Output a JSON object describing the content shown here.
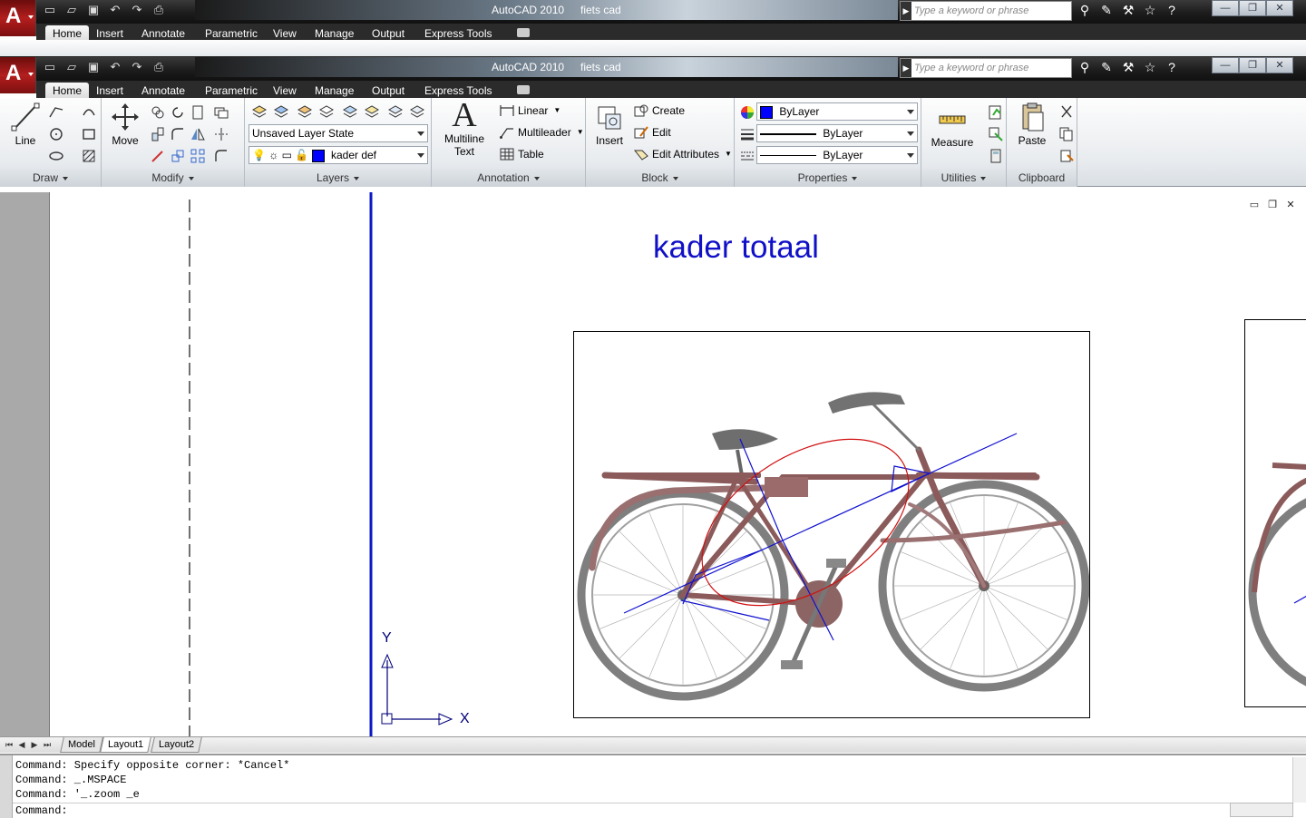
{
  "window": {
    "app_title": "AutoCAD 2010",
    "document_title": "fiets cad",
    "search_placeholder": "Type a keyword or phrase"
  },
  "menu_tabs": [
    "Home",
    "Insert",
    "Annotate",
    "Parametric",
    "View",
    "Manage",
    "Output",
    "Express Tools"
  ],
  "ribbon": {
    "draw": {
      "title": "Draw",
      "line_label": "Line"
    },
    "modify": {
      "title": "Modify",
      "move_label": "Move"
    },
    "layers": {
      "title": "Layers",
      "layer_state": "Unsaved Layer State",
      "current_layer": "kader def"
    },
    "annotation": {
      "title": "Annotation",
      "mtext_line1": "Multiline",
      "mtext_line2": "Text",
      "linear": "Linear",
      "multileader": "Multileader",
      "table": "Table"
    },
    "block": {
      "title": "Block",
      "insert": "Insert",
      "create": "Create",
      "edit": "Edit",
      "edit_attributes": "Edit Attributes"
    },
    "properties": {
      "title": "Properties",
      "color": "ByLayer",
      "lineweight": "ByLayer",
      "linetype": "ByLayer"
    },
    "utilities": {
      "title": "Utilities",
      "measure": "Measure"
    },
    "clipboard": {
      "title": "Clipboard",
      "paste": "Paste"
    }
  },
  "drawing": {
    "sheet_title": "kader totaal",
    "ucs_x": "X",
    "ucs_y": "Y"
  },
  "layout_tabs": [
    "Model",
    "Layout1",
    "Layout2"
  ],
  "command": {
    "history": [
      "Command: Specify opposite corner: *Cancel*",
      "Command: _.MSPACE",
      "Command: '_.zoom _e"
    ],
    "prompt": "Command:"
  },
  "colors": {
    "accent_blue": "#0000ff",
    "title_blue": "#1010c8",
    "frame_red": "#8b5a5a",
    "app_red": "#b41e1e"
  }
}
